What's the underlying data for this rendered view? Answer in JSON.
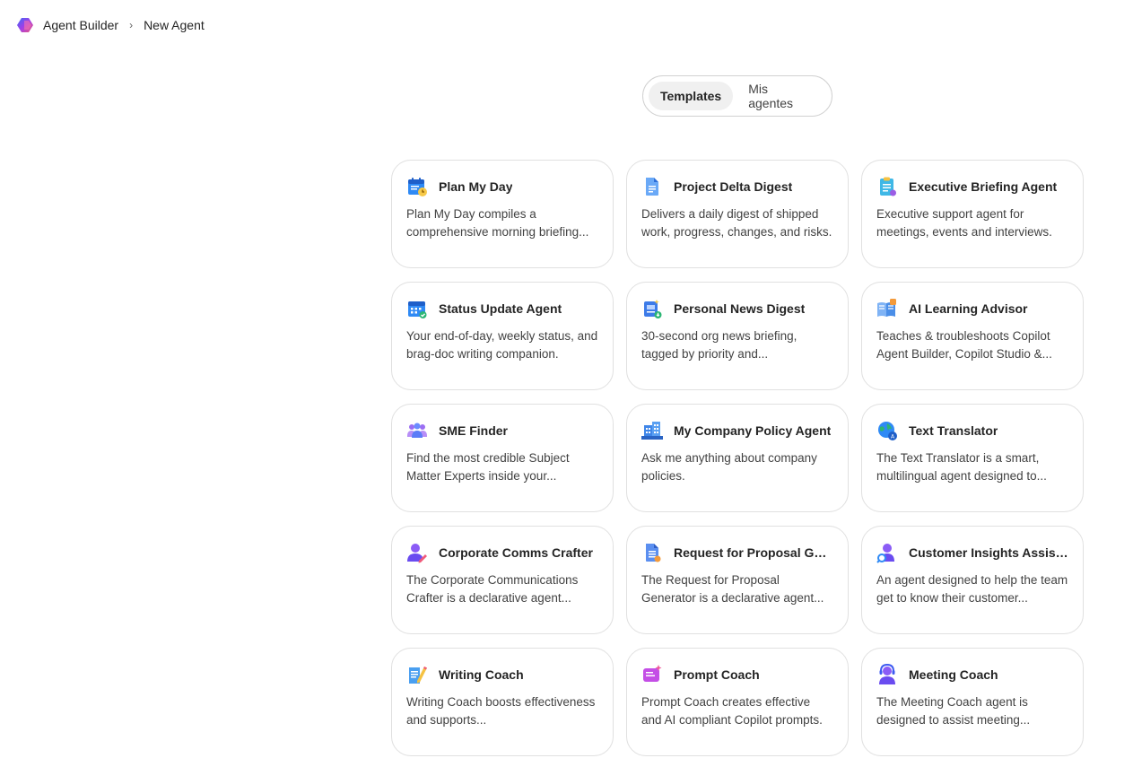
{
  "breadcrumb": {
    "app": "Agent Builder",
    "current": "New Agent",
    "separator": "›"
  },
  "tabs": [
    {
      "label": "Templates",
      "active": true
    },
    {
      "label": "Mis agentes",
      "active": false
    }
  ],
  "cards": [
    {
      "title": "Plan My Day",
      "description": "Plan My Day compiles a comprehensive morning briefing...",
      "icon": "calendar-clock-icon"
    },
    {
      "title": "Project Delta Digest",
      "description": "Delivers a daily digest of shipped work, progress, changes, and risks.",
      "icon": "document-icon"
    },
    {
      "title": "Executive Briefing Agent",
      "description": "Executive support agent for meetings, events and interviews.",
      "icon": "clipboard-icon"
    },
    {
      "title": "Status Update Agent",
      "description": "Your end-of-day, weekly status, and brag-doc writing companion.",
      "icon": "calendar-check-icon"
    },
    {
      "title": "Personal News Digest",
      "description": "30-second org news briefing, tagged by priority and...",
      "icon": "news-icon"
    },
    {
      "title": "AI Learning Advisor",
      "description": "Teaches & troubleshoots Copilot Agent Builder, Copilot Studio &...",
      "icon": "book-icon"
    },
    {
      "title": "SME Finder",
      "description": "Find the most credible Subject Matter Experts inside your...",
      "icon": "people-icon"
    },
    {
      "title": "My Company Policy Agent",
      "description": "Ask me anything about company policies.",
      "icon": "building-icon"
    },
    {
      "title": "Text Translator",
      "description": "The Text Translator is a smart, multilingual agent designed to...",
      "icon": "globe-icon"
    },
    {
      "title": "Corporate Comms Crafter",
      "description": "The Corporate Communications Crafter is a declarative agent...",
      "icon": "person-edit-icon"
    },
    {
      "title": "Request for Proposal Gen...",
      "description": "The Request for Proposal Generator is a declarative agent...",
      "icon": "document-list-icon"
    },
    {
      "title": "Customer Insights Assistant",
      "description": "An agent designed to help the team get to know their customer...",
      "icon": "person-search-icon"
    },
    {
      "title": "Writing Coach",
      "description": "Writing Coach boosts effectiveness and supports...",
      "icon": "pen-doc-icon"
    },
    {
      "title": "Prompt Coach",
      "description": "Prompt Coach creates effective and AI compliant Copilot prompts.",
      "icon": "sparkle-edit-icon"
    },
    {
      "title": "Meeting Coach",
      "description": "The Meeting Coach agent is designed to assist meeting...",
      "icon": "person-headset-icon"
    }
  ]
}
